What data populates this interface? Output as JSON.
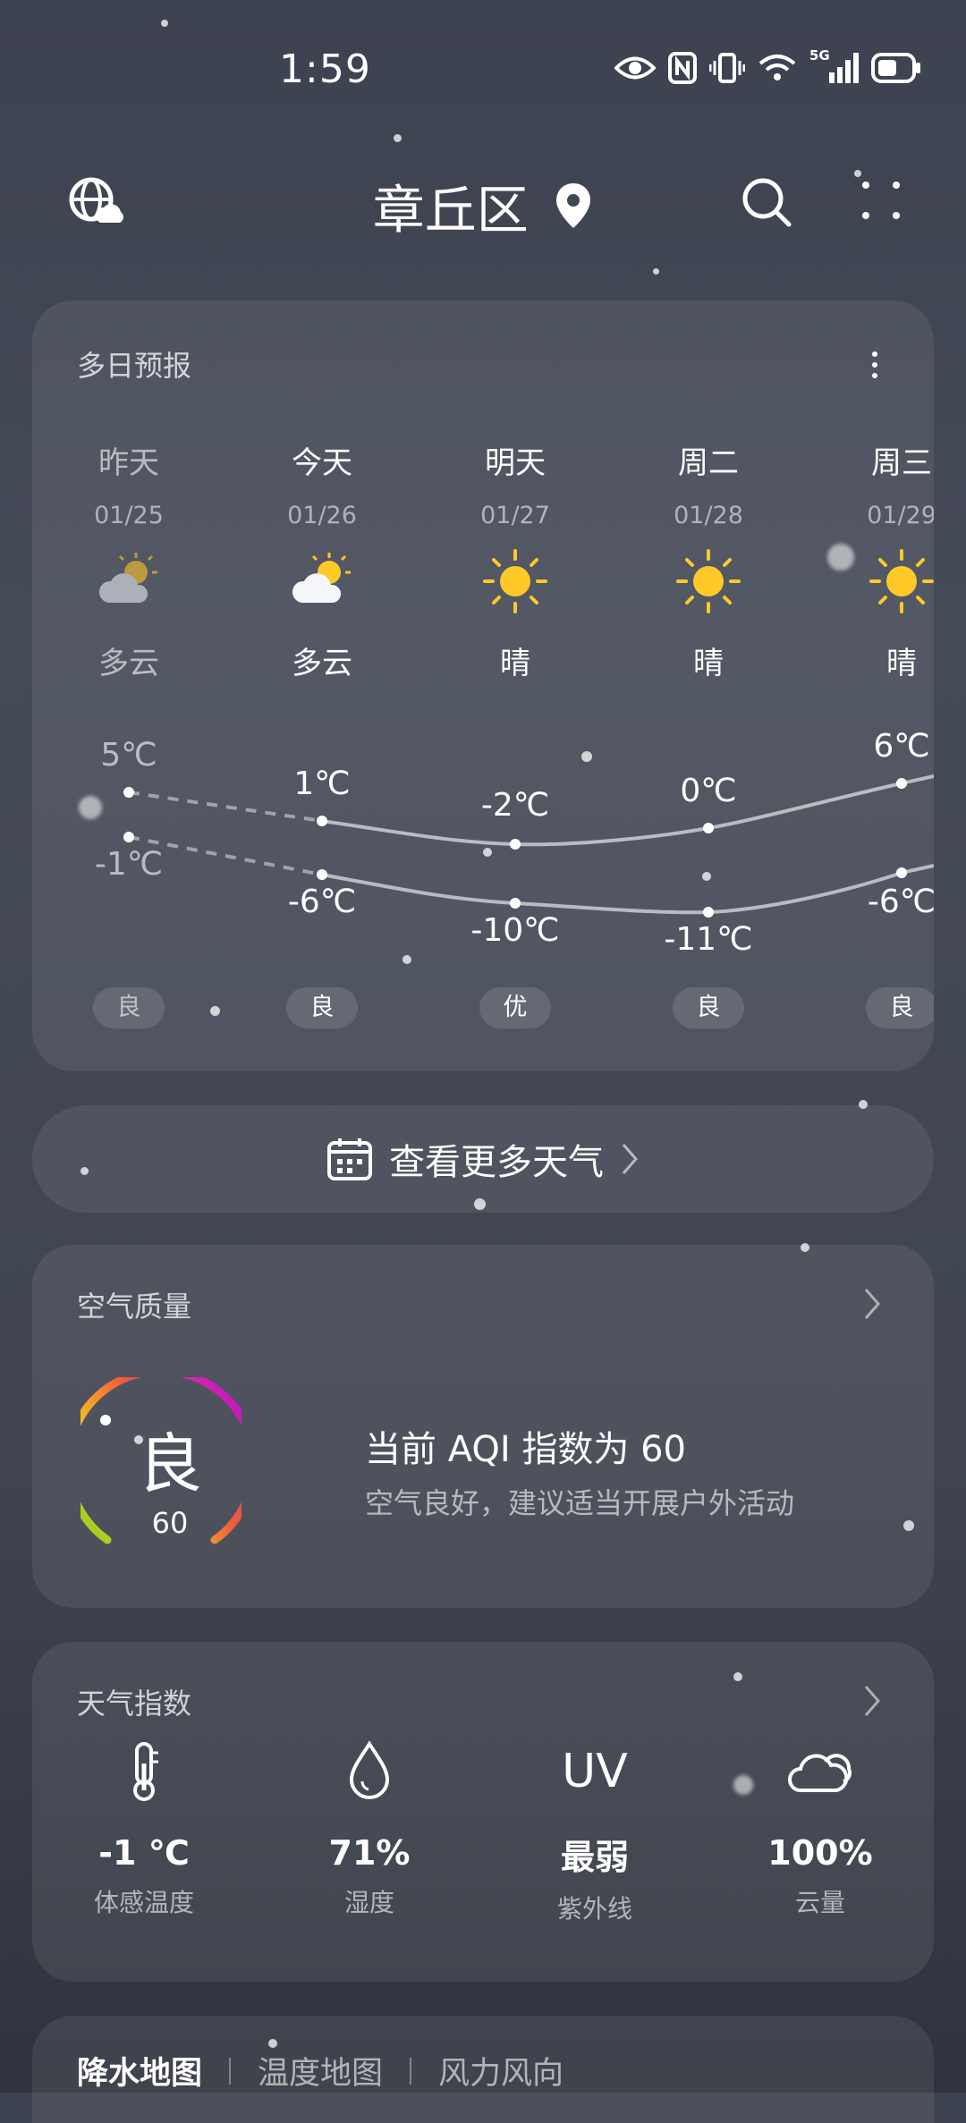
{
  "status": {
    "time": "1:59",
    "network": "5G"
  },
  "header": {
    "city": "章丘区"
  },
  "forecast": {
    "title": "多日预报",
    "days": [
      {
        "name": "昨天",
        "date": "01/25",
        "cond": "多云",
        "icon": "partly-cloudy-icon",
        "high": "5℃",
        "low": "-1℃",
        "aqi": "良"
      },
      {
        "name": "今天",
        "date": "01/26",
        "cond": "多云",
        "icon": "partly-cloudy-icon",
        "high": "1℃",
        "low": "-6℃",
        "aqi": "良"
      },
      {
        "name": "明天",
        "date": "01/27",
        "cond": "晴",
        "icon": "sun-icon",
        "high": "-2℃",
        "low": "-10℃",
        "aqi": "优"
      },
      {
        "name": "周二",
        "date": "01/28",
        "cond": "晴",
        "icon": "sun-icon",
        "high": "0℃",
        "low": "-11℃",
        "aqi": "良"
      },
      {
        "name": "周三",
        "date": "01/29",
        "cond": "晴",
        "icon": "sun-icon",
        "high": "6℃",
        "low": "-6℃",
        "aqi": "良"
      }
    ]
  },
  "more_weather": {
    "label": "查看更多天气"
  },
  "air_quality": {
    "title": "空气质量",
    "level": "良",
    "aqi": "60",
    "aqi_value": 60,
    "headline": "当前 AQI 指数为 60",
    "advice": "空气良好，建议适当开展户外活动"
  },
  "weather_index": {
    "title": "天气指数",
    "items": [
      {
        "icon": "thermometer-icon",
        "value": "-1 ℃",
        "label": "体感温度"
      },
      {
        "icon": "droplet-icon",
        "value": "71%",
        "label": "湿度"
      },
      {
        "icon": "uv-icon",
        "icon_text": "UV",
        "value": "最弱",
        "label": "紫外线"
      },
      {
        "icon": "cloud-icon",
        "value": "100%",
        "label": "云量"
      }
    ]
  },
  "map_tabs": [
    {
      "label": "降水地图"
    },
    {
      "label": "温度地图"
    },
    {
      "label": "风力风向"
    }
  ],
  "colors": {
    "sun": "#FFC928",
    "aqi_gradient": [
      "#7ED321",
      "#F5A623",
      "#F05A3C",
      "#C316C9"
    ]
  }
}
